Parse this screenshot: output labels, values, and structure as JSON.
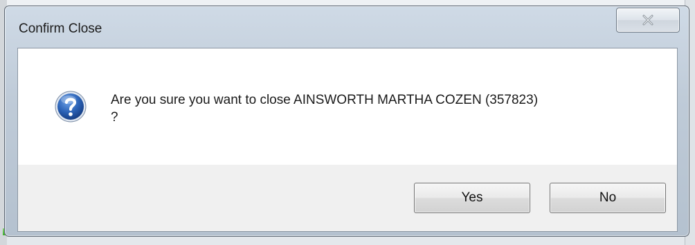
{
  "dialog": {
    "title": "Confirm Close",
    "message_line1": "Are you sure you want to close AINSWORTH MARTHA COZEN (357823)",
    "message_line2": "?",
    "icon": "question-icon",
    "close_icon": "close-icon"
  },
  "buttons": {
    "yes_label": "Yes",
    "no_label": "No"
  },
  "colors": {
    "icon_blue": "#2b62b6",
    "button_area": "#f0f0f0",
    "progress_green": "#3fae2e"
  }
}
